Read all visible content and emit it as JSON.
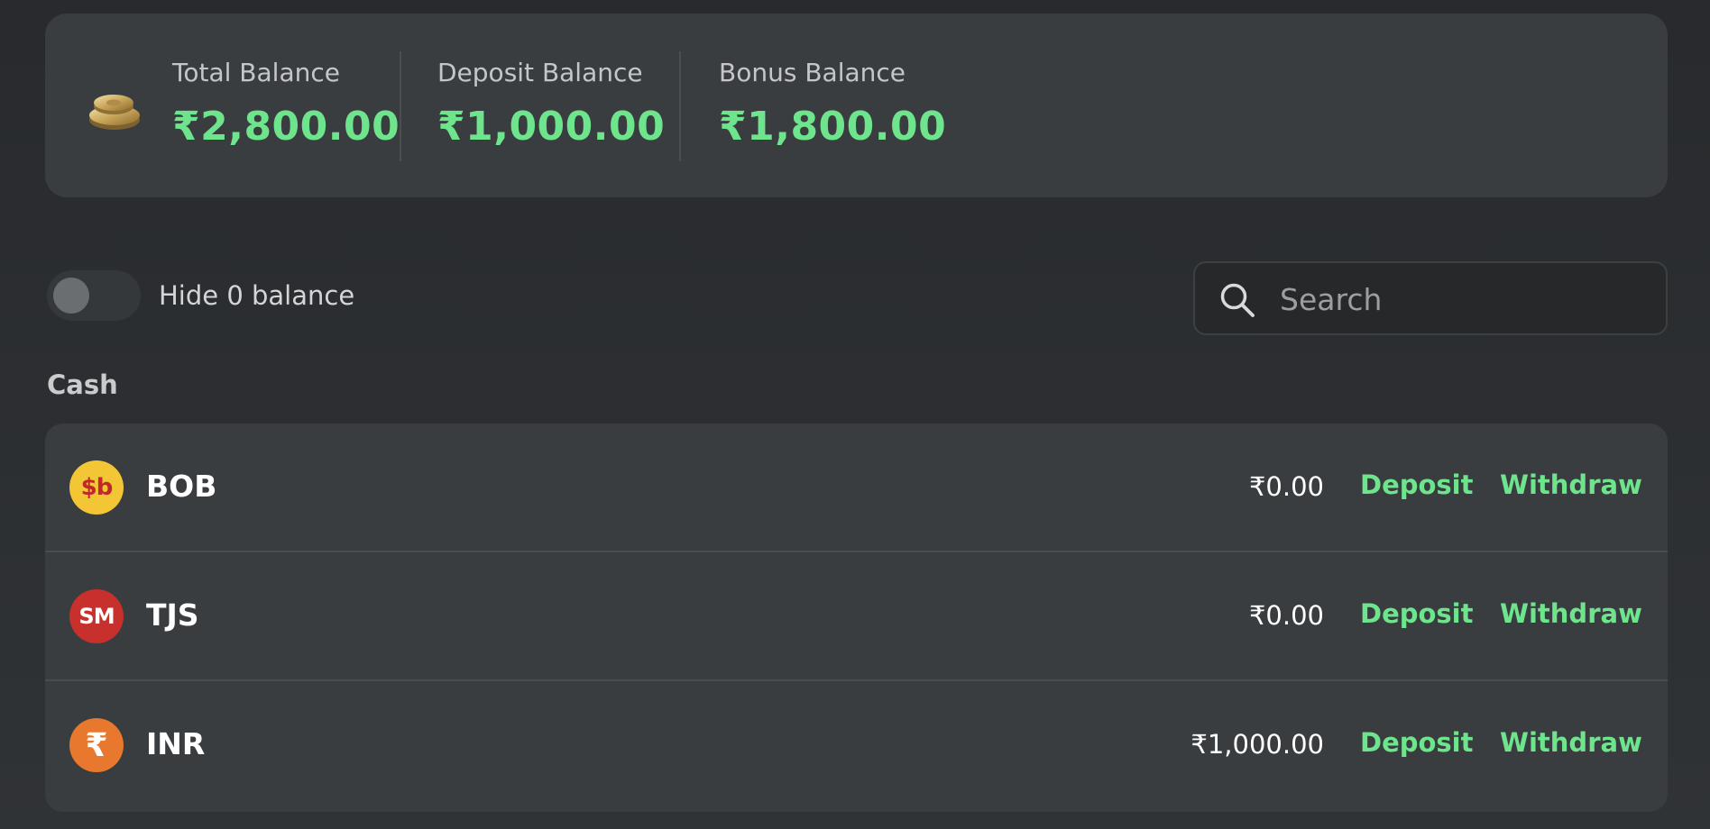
{
  "balances": {
    "total_label": "Total Balance",
    "total_value": "₹2,800.00",
    "deposit_label": "Deposit Balance",
    "deposit_value": "₹1,000.00",
    "bonus_label": "Bonus Balance",
    "bonus_value": "₹1,800.00"
  },
  "filter": {
    "hide_zero_label": "Hide 0 balance",
    "hide_zero_on": false
  },
  "search": {
    "placeholder": "Search",
    "icon": "search-icon"
  },
  "section": {
    "title": "Cash"
  },
  "currencies": [
    {
      "code": "BOB",
      "icon_text": "$b",
      "amount": "₹0.00",
      "deposit_label": "Deposit",
      "withdraw_label": "Withdraw"
    },
    {
      "code": "TJS",
      "icon_text": "SM",
      "amount": "₹0.00",
      "deposit_label": "Deposit",
      "withdraw_label": "Withdraw"
    },
    {
      "code": "INR",
      "icon_text": "₹",
      "amount": "₹1,000.00",
      "deposit_label": "Deposit",
      "withdraw_label": "Withdraw"
    }
  ],
  "colors": {
    "accent_green": "#6ee48d",
    "background": "#2d3033",
    "card": "#3a3d40"
  }
}
